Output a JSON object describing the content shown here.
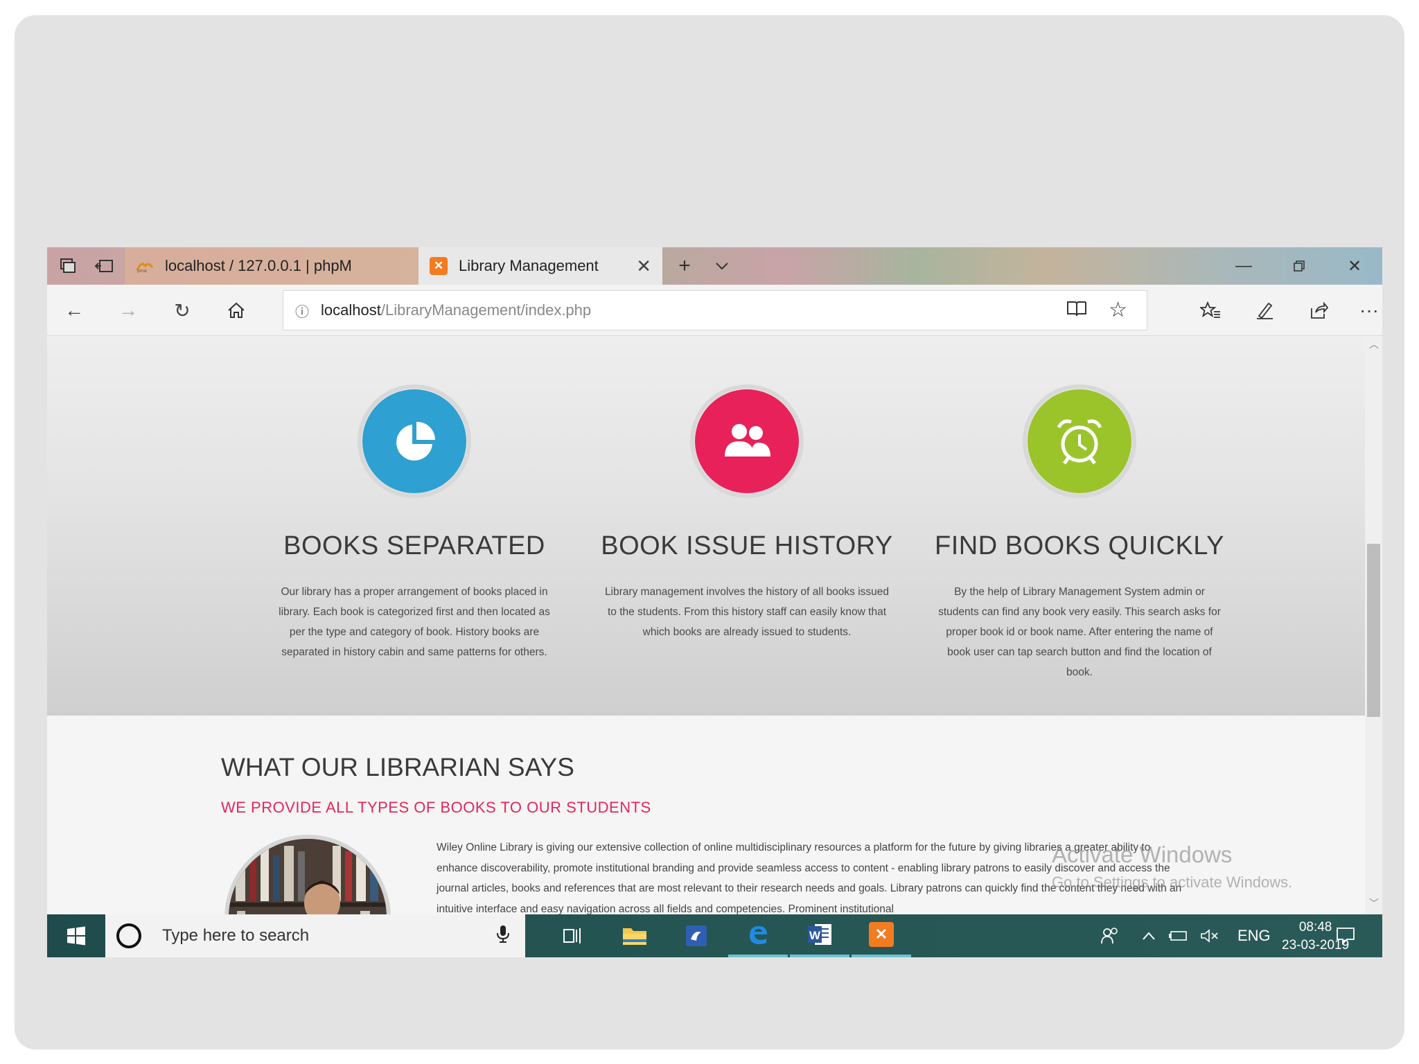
{
  "browser": {
    "tabs": [
      {
        "label": "localhost / 127.0.0.1 | phpM"
      },
      {
        "label": "Library Management"
      }
    ],
    "address": {
      "host": "localhost",
      "path": "/LibraryManagement/index.php"
    }
  },
  "features": [
    {
      "icon": "pie-chart-icon",
      "color": "#2ea0d1",
      "title": "BOOKS SEPARATED",
      "text": "Our library has a proper arrangement of books placed in library. Each book is categorized first and then located as per the type and category of book. History books are separated in history cabin and same patterns for others."
    },
    {
      "icon": "users-icon",
      "color": "#e8215a",
      "title": "BOOK ISSUE HISTORY",
      "text": "Library management involves the history of all books issued to the students. From this history staff can easily know that which books are already issued to students."
    },
    {
      "icon": "alarm-clock-icon",
      "color": "#9ac42a",
      "title": "FIND BOOKS QUICKLY",
      "text": "By the help of Library Management System admin or students can find any book very easily. This search asks for proper book id or book name. After entering the name of book user can tap search button and find the location of book."
    }
  ],
  "librarian": {
    "title": "WHAT OUR LIBRARIAN SAYS",
    "subtitle": "WE PROVIDE ALL TYPES OF BOOKS TO OUR STUDENTS",
    "text": "Wiley Online Library is giving our extensive collection of online multidisciplinary resources a platform for the future by giving libraries a greater ability to enhance discoverability, promote institutional branding and provide seamless access to content - enabling library patrons to easily discover and access the journal articles, books and references that are most relevant to their research needs and goals. Library patrons can quickly find the content they need with an intuitive interface and easy navigation across all fields and competencies. Prominent institutional"
  },
  "watermark": {
    "line1": "Activate Windows",
    "line2": "Go to Settings to activate Windows."
  },
  "taskbar": {
    "search_placeholder": "Type here to search",
    "language": "ENG",
    "time": "08:48",
    "date": "23-03-2019"
  }
}
